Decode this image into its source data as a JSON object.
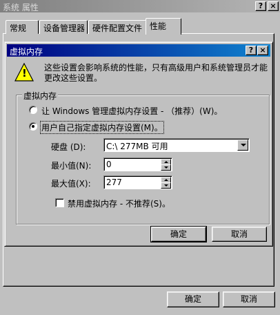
{
  "window": {
    "title": "系统 属性",
    "help_glyph": "?",
    "close_glyph": "×"
  },
  "tabs": [
    {
      "label": "常规"
    },
    {
      "label": "设备管理器"
    },
    {
      "label": "硬件配置文件"
    },
    {
      "label": "性能"
    }
  ],
  "dialog": {
    "title": "虚拟内存",
    "help_glyph": "?",
    "close_glyph": "×",
    "warning_glyph": "!",
    "warning_text": "这些设置会影响系统的性能，只有高级用户和系统管理员才能更改这些设置。",
    "group_label": "虚拟内存",
    "radio_windows_label": "让 Windows 管理虚拟内存设置 - （推荐）(W)。",
    "radio_custom_label": "用户自己指定虚拟内存设置(M)。",
    "disk_label": "硬盘 (D):",
    "disk_value": "C:\\ 277MB 可用",
    "min_label": "最小值(N):",
    "min_value": "0",
    "max_label": "最大值(X):",
    "max_value": "277",
    "disable_label": "禁用虚拟内存 - 不推荐(S)。",
    "ok_label": "确定",
    "cancel_label": "取消"
  },
  "footer": {
    "ok_label": "确定",
    "cancel_label": "取消"
  }
}
